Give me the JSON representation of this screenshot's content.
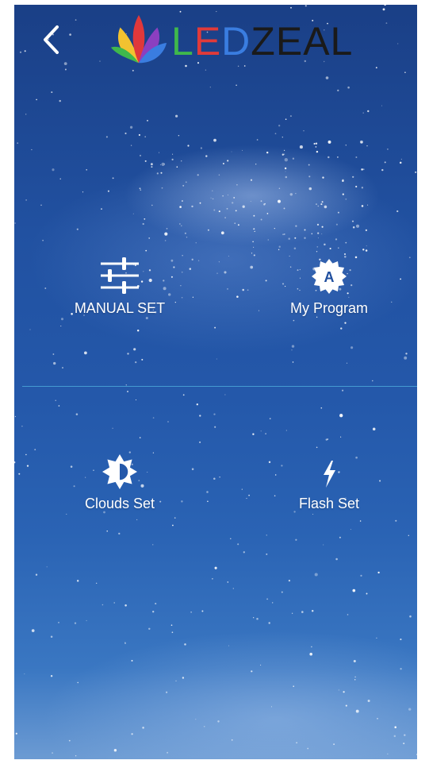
{
  "header": {
    "back_icon": "chevron-left-icon",
    "logo": {
      "letters": [
        {
          "char": "L",
          "color": "#3fb84c"
        },
        {
          "char": "E",
          "color": "#e03a3a"
        },
        {
          "char": "D",
          "color": "#3a7de0"
        },
        {
          "char": "Z",
          "color": "#1a1a1a"
        },
        {
          "char": "E",
          "color": "#1a1a1a"
        },
        {
          "char": "A",
          "color": "#1a1a1a"
        },
        {
          "char": "L",
          "color": "#1a1a1a"
        }
      ]
    }
  },
  "menu": {
    "manual_set": {
      "label": "MANUAL SET",
      "icon": "sliders-icon"
    },
    "my_program": {
      "label": "My Program",
      "icon": "badge-a-icon"
    },
    "clouds_set": {
      "label": "Clouds Set",
      "icon": "brightness-icon"
    },
    "flash_set": {
      "label": "Flash Set",
      "icon": "lightning-icon"
    }
  },
  "colors": {
    "divider": "#4aa7d8",
    "text": "#ffffff"
  }
}
